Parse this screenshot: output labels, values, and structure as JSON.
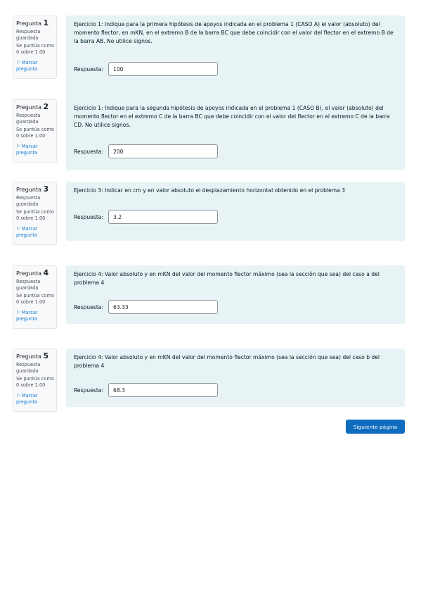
{
  "questions": [
    {
      "label": "Pregunta",
      "number": "1",
      "state": "Respuesta guardada",
      "grade": "Se puntúa como 0 sobre 1.00",
      "flag": "Marcar pregunta",
      "text": "Ejercicio 1: Indique  para la primera hipótesis de apoyos indicada en el problema 1 (CASO A)   el valor (absoluto) del momento flector, en mKN, en el extremo B de la barra BC que debe coincidir con el valor del flector en el extremo B de la barra AB. No utilice signos.",
      "answer_label": "Respuesta:",
      "answer_value": "100"
    },
    {
      "label": "Pregunta",
      "number": "2",
      "state": "Respuesta guardada",
      "grade": "Se puntúa como 0 sobre 1.00",
      "flag": "Marcar pregunta",
      "text": "Ejercicio 1: Indique  para la segunda hipótesis de apoyos indicada en el problema 1 (CASO B),  el valor (absoluto) del momento flector en el extremo C de la barra BC que debe coincidir con el valor del flector en el extremo C de la barra CD. No utilice signos.",
      "answer_label": "Respuesta:",
      "answer_value": "200"
    },
    {
      "label": "Pregunta",
      "number": "3",
      "state": "Respuesta guardada",
      "grade": "Se puntúa como 0 sobre 1.00",
      "flag": "Marcar pregunta",
      "text": "Ejercicio 3: Indicar en cm y en valor absoluto el desplazamiento horizontal obtenido en el problema 3",
      "answer_label": "Respuesta:",
      "answer_value": "3.2"
    },
    {
      "label": "Pregunta",
      "number": "4",
      "state": "Respuesta guardada",
      "grade": "Se puntúa como 0 sobre 1.00",
      "flag": "Marcar pregunta",
      "text": "Ejercicio 4: Valor absoluto y en mKN del valor del momento flector máximo (sea la sección que sea) del caso a del problema 4",
      "answer_label": "Respuesta:",
      "answer_value": "63.33"
    },
    {
      "label": "Pregunta",
      "number": "5",
      "state": "Respuesta guardada",
      "grade": "Se puntúa como 0 sobre 1.00",
      "flag": "Marcar pregunta",
      "text": "Ejercicio 4: Valor absoluto y en mKN del valor del momento flector máximo (sea la sección que sea) del caso b del problema 4",
      "answer_label": "Respuesta:",
      "answer_value": "68.3"
    }
  ],
  "next_button": "Siguiente página",
  "colors": {
    "content_bg": "#e7f3f5",
    "info_bg": "#f8f9fa",
    "link": "#1177d1",
    "primary_button": "#0f6cbf"
  },
  "icons": {
    "flag": "flag-outline-icon"
  }
}
